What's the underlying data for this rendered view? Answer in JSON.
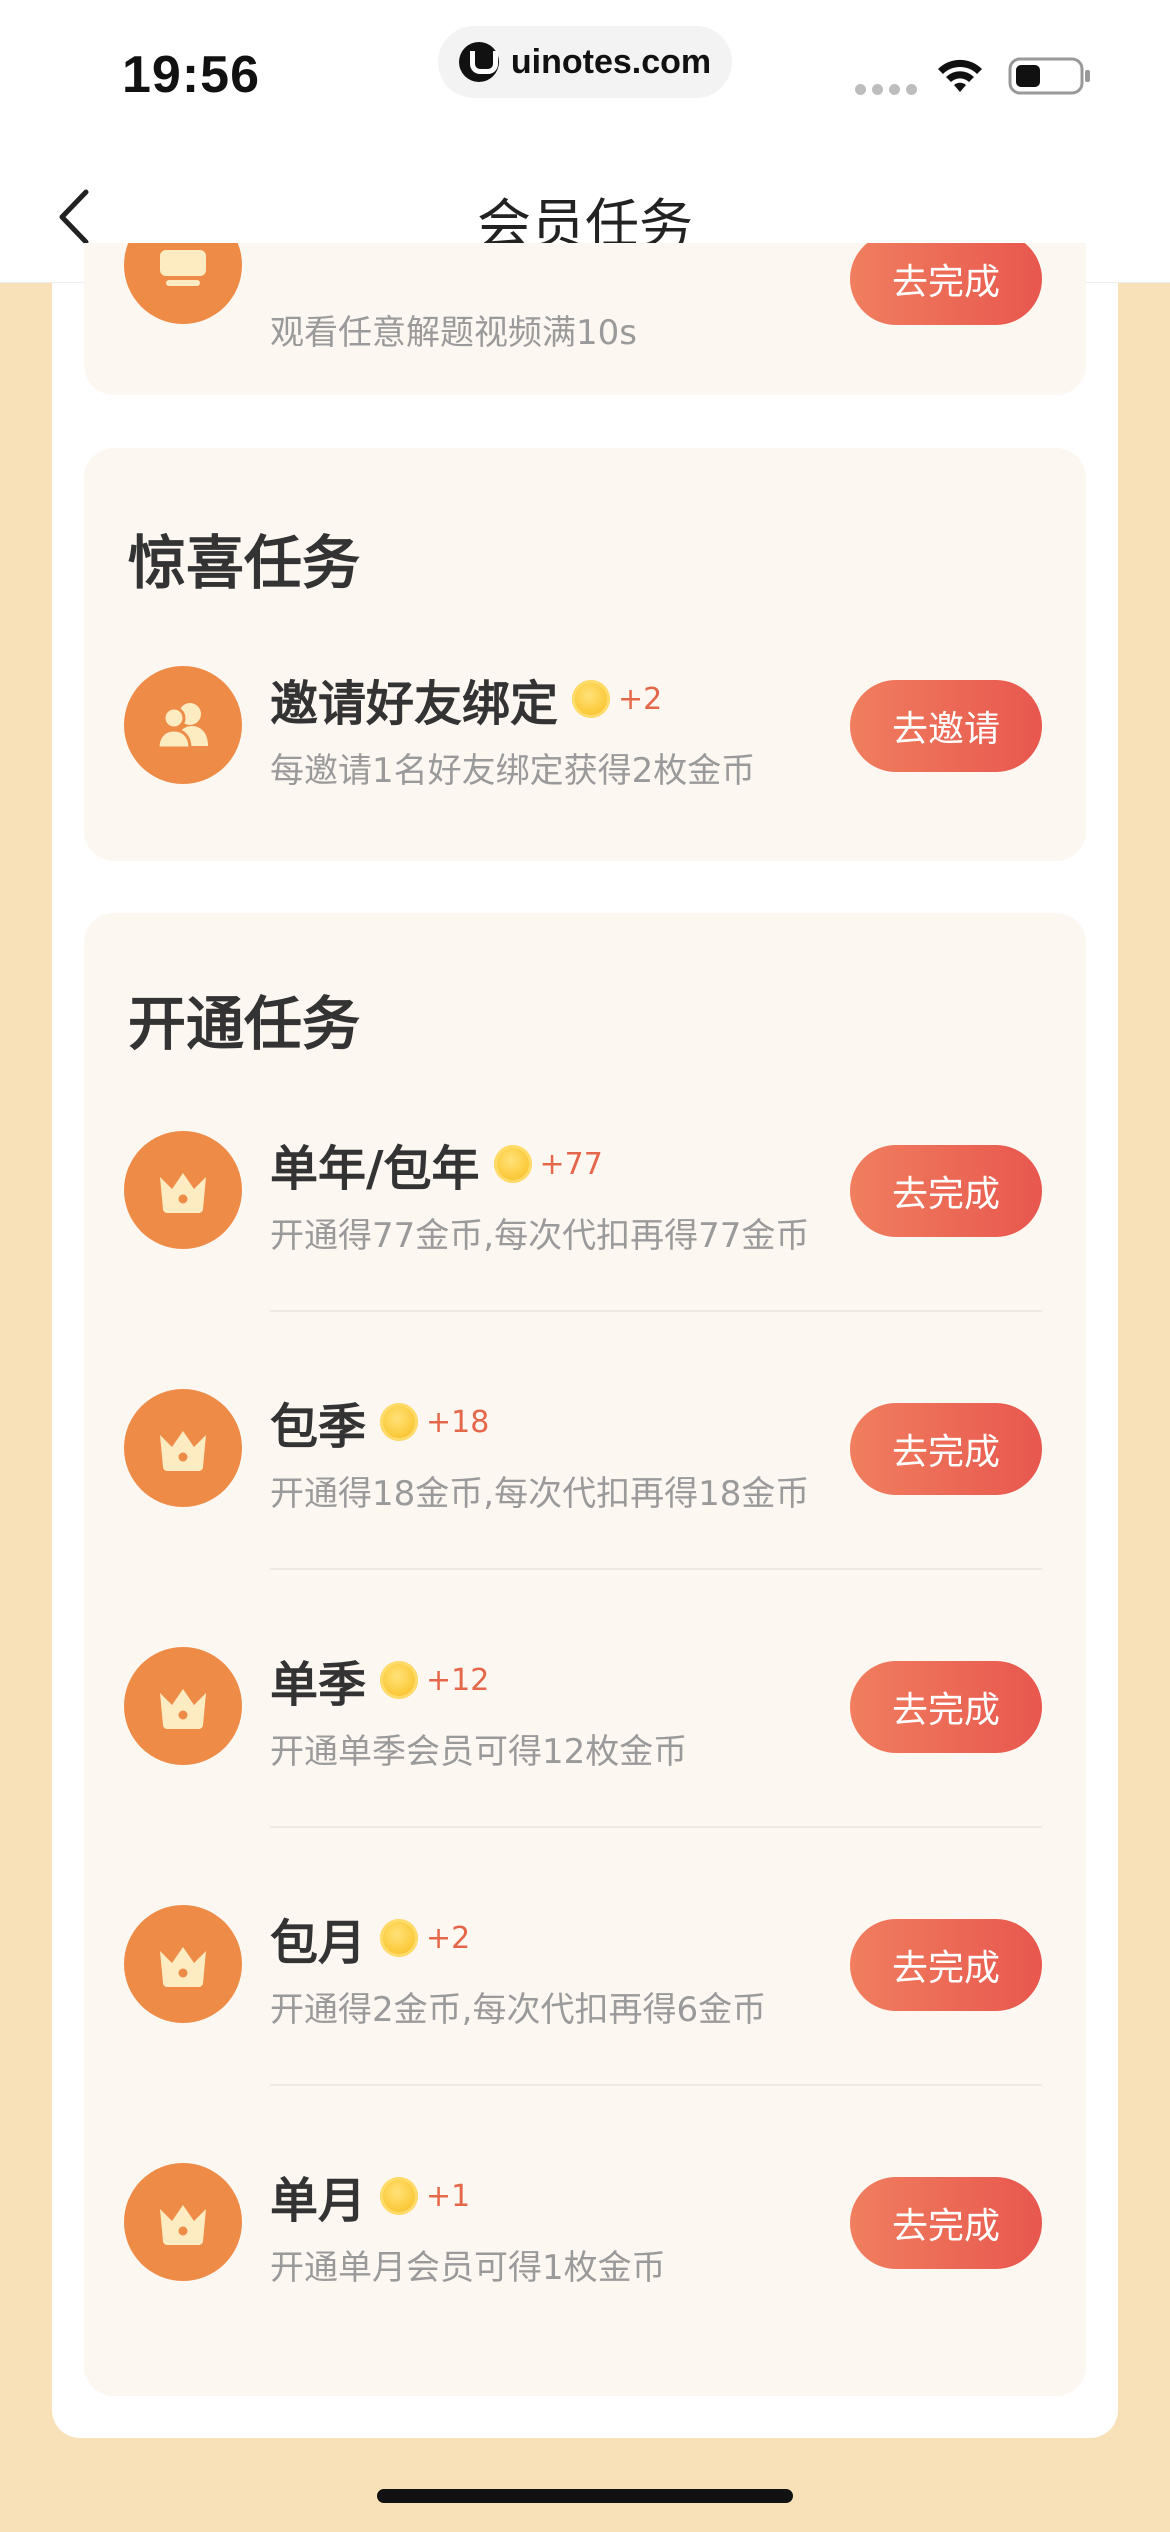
{
  "status_bar": {
    "time": "19:56",
    "url": "uinotes.com"
  },
  "nav": {
    "title": "会员任务"
  },
  "colors": {
    "background": "#F8E1B8",
    "section_bg": "#FDF7F1",
    "icon_circle": "#EE8B47",
    "button_start": "#F07E5F",
    "button_end": "#E8574E",
    "coin_amount": "#E5674A"
  },
  "partial_task": {
    "desc": "观看任意解题视频满10s",
    "button": "去完成",
    "icon": "tv-icon"
  },
  "surprise_section": {
    "title": "惊喜任务",
    "tasks": [
      {
        "title": "邀请好友绑定",
        "coins": "+2",
        "desc": "每邀请1名好友绑定获得2枚金币",
        "button": "去邀请",
        "icon": "users-icon"
      }
    ]
  },
  "open_section": {
    "title": "开通任务",
    "tasks": [
      {
        "title": "单年/包年",
        "coins": "+77",
        "desc": "开通得77金币,每次代扣再得77金币",
        "button": "去完成",
        "icon": "crown-icon"
      },
      {
        "title": "包季",
        "coins": "+18",
        "desc": "开通得18金币,每次代扣再得18金币",
        "button": "去完成",
        "icon": "crown-icon"
      },
      {
        "title": "单季",
        "coins": "+12",
        "desc": "开通单季会员可得12枚金币",
        "button": "去完成",
        "icon": "crown-icon"
      },
      {
        "title": "包月",
        "coins": "+2",
        "desc": "开通得2金币,每次代扣再得6金币",
        "button": "去完成",
        "icon": "crown-icon"
      },
      {
        "title": "单月",
        "coins": "+1",
        "desc": "开通单月会员可得1枚金币",
        "button": "去完成",
        "icon": "crown-icon"
      }
    ]
  }
}
